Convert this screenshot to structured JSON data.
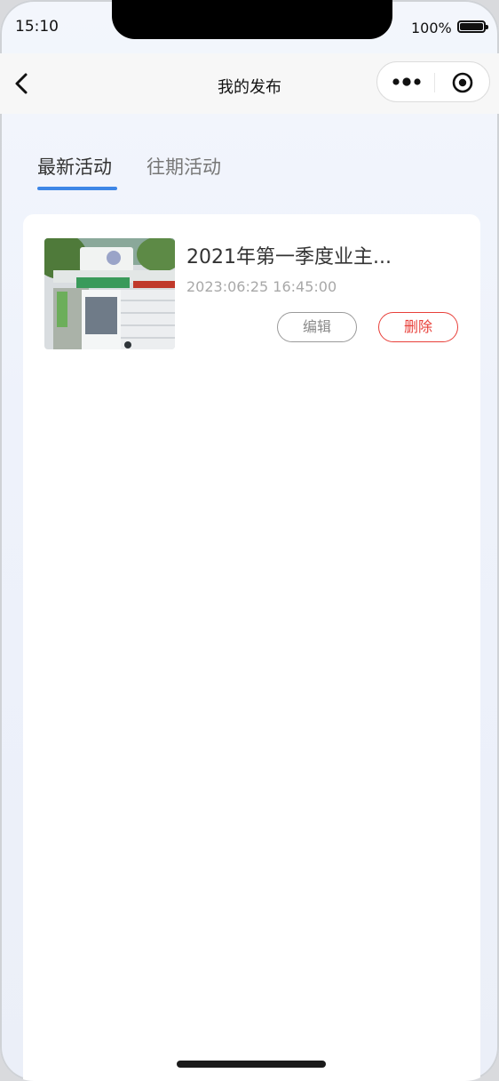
{
  "status_bar": {
    "time": "15:10",
    "battery_text": "100%"
  },
  "navbar": {
    "title": "我的发布"
  },
  "tabs": [
    {
      "label": "最新活动",
      "active": true
    },
    {
      "label": "往期活动",
      "active": false
    }
  ],
  "items": [
    {
      "title": "2021年第一季度业主...",
      "date": "2023:06:25 16:45:00",
      "edit_label": "编辑",
      "delete_label": "删除"
    }
  ],
  "colors": {
    "accent": "#3e86e6",
    "danger": "#e8403a"
  },
  "icons": {
    "back": "chevron-left-icon",
    "more": "more-dots-icon",
    "close": "target-circle-icon"
  }
}
